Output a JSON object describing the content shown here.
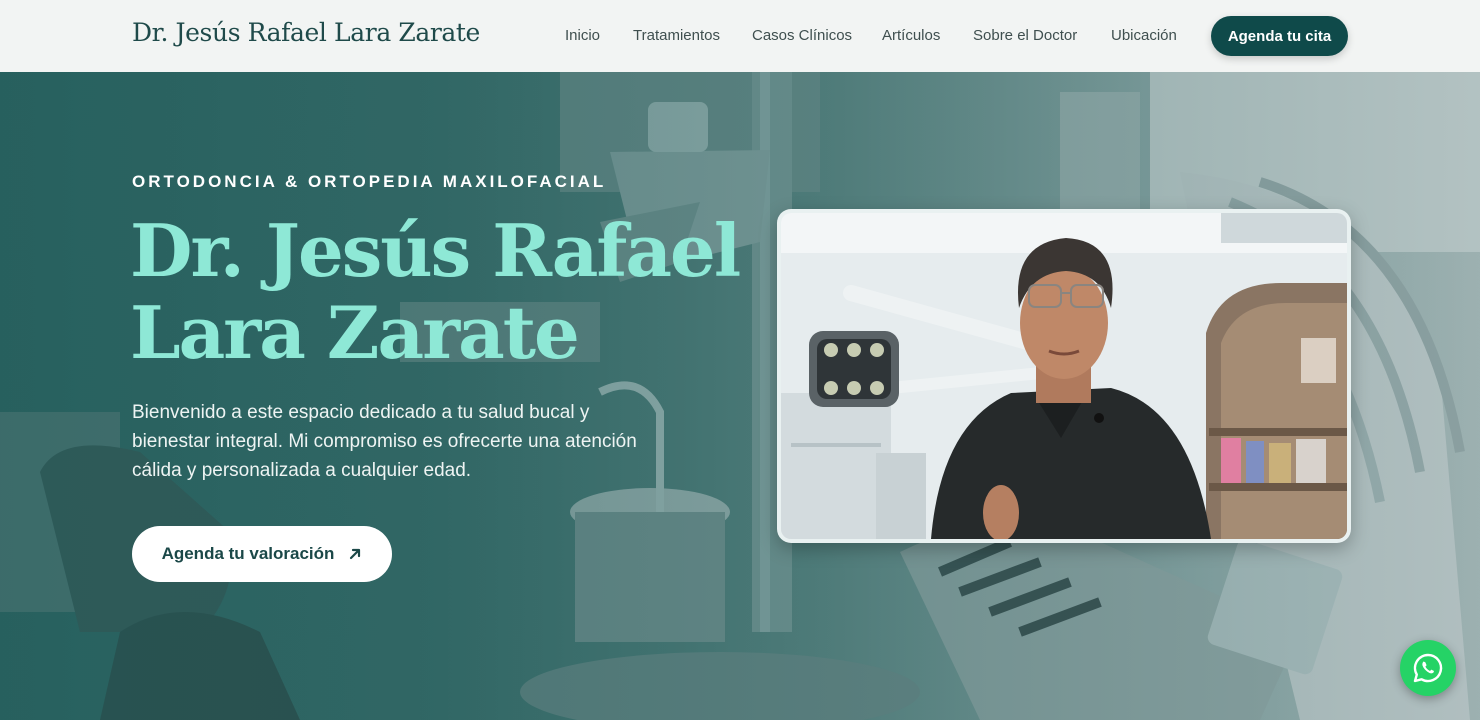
{
  "header": {
    "brand": "Dr. Jesús Rafael Lara Zarate",
    "nav": [
      "Inicio",
      "Tratamientos",
      "Casos Clínicos",
      "Artículos",
      "Sobre el Doctor",
      "Ubicación"
    ],
    "cta": "Agenda tu cita"
  },
  "hero": {
    "eyebrow": "ORTODONCIA & ORTOPEDIA MAXILOFACIAL",
    "title_line1": "Dr. Jesús Rafael",
    "title_line2": "Lara Zarate",
    "description": "Bienvenido a este espacio dedicado a tu salud bucal y bienestar integral. Mi compromiso es ofrecerte una atención cálida y personalizada a cualquier edad.",
    "cta": "Agenda tu valoración",
    "cta_icon": "arrow-up-right-icon"
  },
  "floating": {
    "icon": "whatsapp-icon"
  },
  "colors": {
    "brand_dark": "#0f4a4a",
    "title_mint": "#8ee8d6",
    "whatsapp": "#25d366",
    "header_bg": "#f2f4f3"
  }
}
